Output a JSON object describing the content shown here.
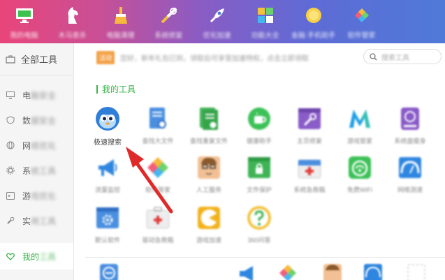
{
  "topnav": [
    {
      "icon": "monitor-icon",
      "label": "我的电脑"
    },
    {
      "icon": "horse-icon",
      "label": "木马查杀"
    },
    {
      "icon": "broom-icon",
      "label": "电脑清理"
    },
    {
      "icon": "tools-icon",
      "label": "系统修复"
    },
    {
      "icon": "rocket-icon",
      "label": "优化加速"
    },
    {
      "icon": "apps-icon",
      "label": "功能大全"
    },
    {
      "icon": "coin-icon",
      "label": "金融·手机助手"
    },
    {
      "icon": "store-icon",
      "label": "软件管家"
    }
  ],
  "sidebar": {
    "all_tools": "全部工具",
    "items": [
      {
        "icon": "monitor-icon",
        "prefix": "电",
        "rest": "脑安全"
      },
      {
        "icon": "shield-icon",
        "prefix": "数",
        "rest": "据安全"
      },
      {
        "icon": "globe-icon",
        "prefix": "网",
        "rest": "络优化"
      },
      {
        "icon": "gear-icon",
        "prefix": "系",
        "rest": "统工具"
      },
      {
        "icon": "gamepad-icon",
        "prefix": "游",
        "rest": "戏优化"
      },
      {
        "icon": "wrench-icon",
        "prefix": "实",
        "rest": "用工具"
      }
    ],
    "active": {
      "icon": "heart-icon",
      "prefix": "我的",
      "rest": "工具"
    }
  },
  "notice": {
    "badge": "活动",
    "text": "您好，新年礼包已到，领取后可享受加速特权，点击立即领取"
  },
  "search": {
    "placeholder": "搜索工具"
  },
  "section_title": "我的工具",
  "tools_row1": [
    {
      "icon": "speed-search-icon",
      "label": "极速搜索"
    },
    {
      "icon": "file-search-icon",
      "label": "查找大文件"
    },
    {
      "icon": "duplicate-file-icon",
      "label": "查找重复文件"
    },
    {
      "icon": "cup-icon",
      "label": "健康助手"
    },
    {
      "icon": "repair-icon",
      "label": "主页修复"
    },
    {
      "icon": "m-icon",
      "label": "游戏管家"
    },
    {
      "icon": "disk-icon",
      "label": "系统盘瘦身"
    }
  ],
  "tools_row2": [
    {
      "icon": "megaphone-icon",
      "label": "流量监控"
    },
    {
      "icon": "flower-icon",
      "label": "软件管家"
    },
    {
      "icon": "person-icon",
      "label": "人工服务"
    },
    {
      "icon": "lock-folder-icon",
      "label": "文件保护"
    },
    {
      "icon": "firstaid-icon",
      "label": "系统急救箱"
    },
    {
      "icon": "wifi-icon",
      "label": "免费WiFi"
    },
    {
      "icon": "speedometer-icon",
      "label": "网络测速"
    }
  ],
  "tools_row3": [
    {
      "icon": "settings-window-icon",
      "label": "默认软件"
    },
    {
      "icon": "medkit-icon",
      "label": "驱动急救箱"
    },
    {
      "icon": "pacman-icon",
      "label": "游戏加速"
    },
    {
      "icon": "question-icon",
      "label": "360问答"
    }
  ],
  "colors": {
    "accent": "#39b54a",
    "arrow": "#e02a2a",
    "header_start": "#e8457a",
    "header_end": "#4f7ad8"
  }
}
